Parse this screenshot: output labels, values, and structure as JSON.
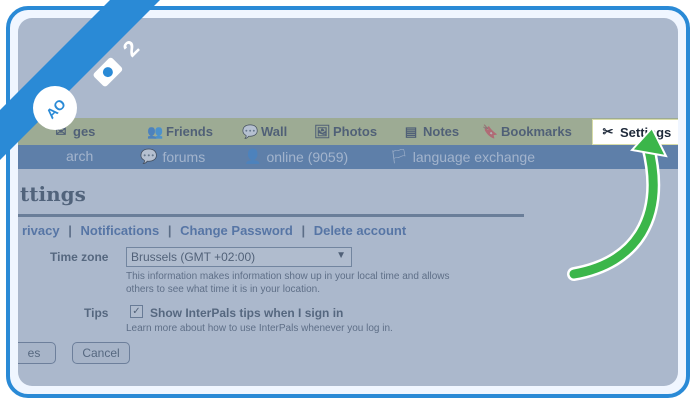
{
  "menu": {
    "items": [
      {
        "label": "ges",
        "icon": "messages-icon"
      },
      {
        "label": "Friends",
        "icon": "friends-icon"
      },
      {
        "label": "Wall",
        "icon": "wall-icon"
      },
      {
        "label": "Photos",
        "icon": "photos-icon"
      },
      {
        "label": "Notes",
        "icon": "notes-icon"
      },
      {
        "label": "Bookmarks",
        "icon": "bookmarks-icon"
      },
      {
        "label": "Settings",
        "icon": "settings-icon"
      }
    ]
  },
  "subnav": {
    "search": "arch",
    "forums": "forums",
    "online": "online (9059)",
    "language": "language exchange"
  },
  "page": {
    "title": "ttings"
  },
  "tabs": [
    "rivacy",
    "Notifications",
    "Change Password",
    "Delete account"
  ],
  "form": {
    "timezone_label": "Time zone",
    "timezone_value": "Brussels (GMT +02:00)",
    "timezone_help": "This information makes information show up in your local time and allows others to see what time it is in your location.",
    "tips_label": "Tips",
    "tips_checkbox_label": "Show InterPals tips when I sign in",
    "tips_help": "Learn more about how to use InterPals whenever you log in.",
    "save_label": "es",
    "cancel_label": "Cancel"
  },
  "ribbon": {
    "step": "2"
  },
  "colors": {
    "frame": "#2a8ad6",
    "menubar": "#c9d07a",
    "subnav": "#3e6fa8",
    "arrow": "#3bb64a"
  }
}
